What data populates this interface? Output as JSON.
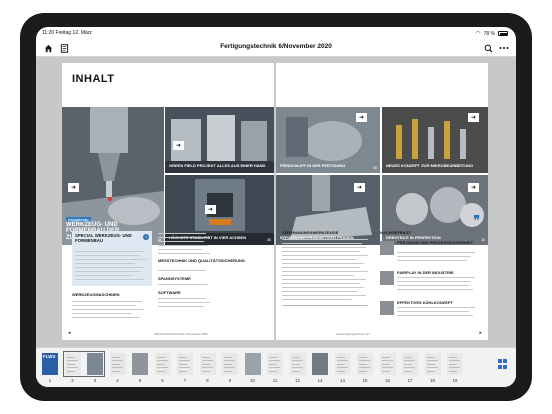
{
  "status_bar": {
    "time_date": "11:20  Freitag 12. März",
    "signal": "ᯤ",
    "battery": "78 %"
  },
  "toolbar": {
    "title": "Fertigungstechnik 6/November 2020"
  },
  "magazine": {
    "heading": "INHALT",
    "cover_tag": "COVERSTORY",
    "cover_caption": "WERKZEUG- UND FORMENBAU DER ZUKUNFT",
    "cover_page": "14",
    "tiles": [
      {
        "caption": "GREEN FIELD PROJEKT ALLES AUS EINER HAND"
      },
      {
        "caption": "FEINSCHLIFF IN DER FERTIGUNG",
        "page": "46"
      },
      {
        "caption": "NEUES KONZEPT ZUR MIKROBEARBEITUNG"
      },
      {
        "caption": "HÖCHSTE STABILITÄT IN VIER ACHSEN",
        "page": "38"
      },
      {
        "caption": "EFFIZIENTER PRODUKTIVER FRÄSEN"
      },
      {
        "caption": "DREHTEILE IN PERFEKTION",
        "page": "35"
      }
    ],
    "special_heading": "SPECIAL WERKZEUG- UND FORMENBAU",
    "info_icon": "i",
    "sections_left": {
      "werkzeugmaschinen": "WERKZEUGMASCHINEN",
      "messtechnik": "MESSTECHNIK UND QUALITÄTSSICHERUNG",
      "spannsysteme": "SPANNSYSTEME",
      "software": "SOFTWARE"
    },
    "sections_right": {
      "zerspanung": "ZERSPANUNGSWERKZEUGE",
      "nachgefragt": "NACHGEFRAGT",
      "praezision": "PRÄZISION UND PROZESSSICHERHEIT",
      "fairplay": "FAIRPLAY IN DER INDUSTRIE",
      "kuehlkonzept": "EFFEKTIVES KÜHLKONZEPT"
    },
    "footer_left": "FERTIGUNGSTECHNIK 6/November 2020",
    "footer_right": "www.fertigungstechnik.com",
    "prev_arrow": "◂",
    "next_arrow": "▸"
  },
  "thumbnails": {
    "page_numbers": [
      "1",
      "2",
      "3",
      "4",
      "5",
      "6",
      "7",
      "8",
      "9",
      "10",
      "11",
      "12",
      "13",
      "14",
      "15",
      "16",
      "17",
      "18",
      "19"
    ],
    "cover_text": "FLWX"
  }
}
